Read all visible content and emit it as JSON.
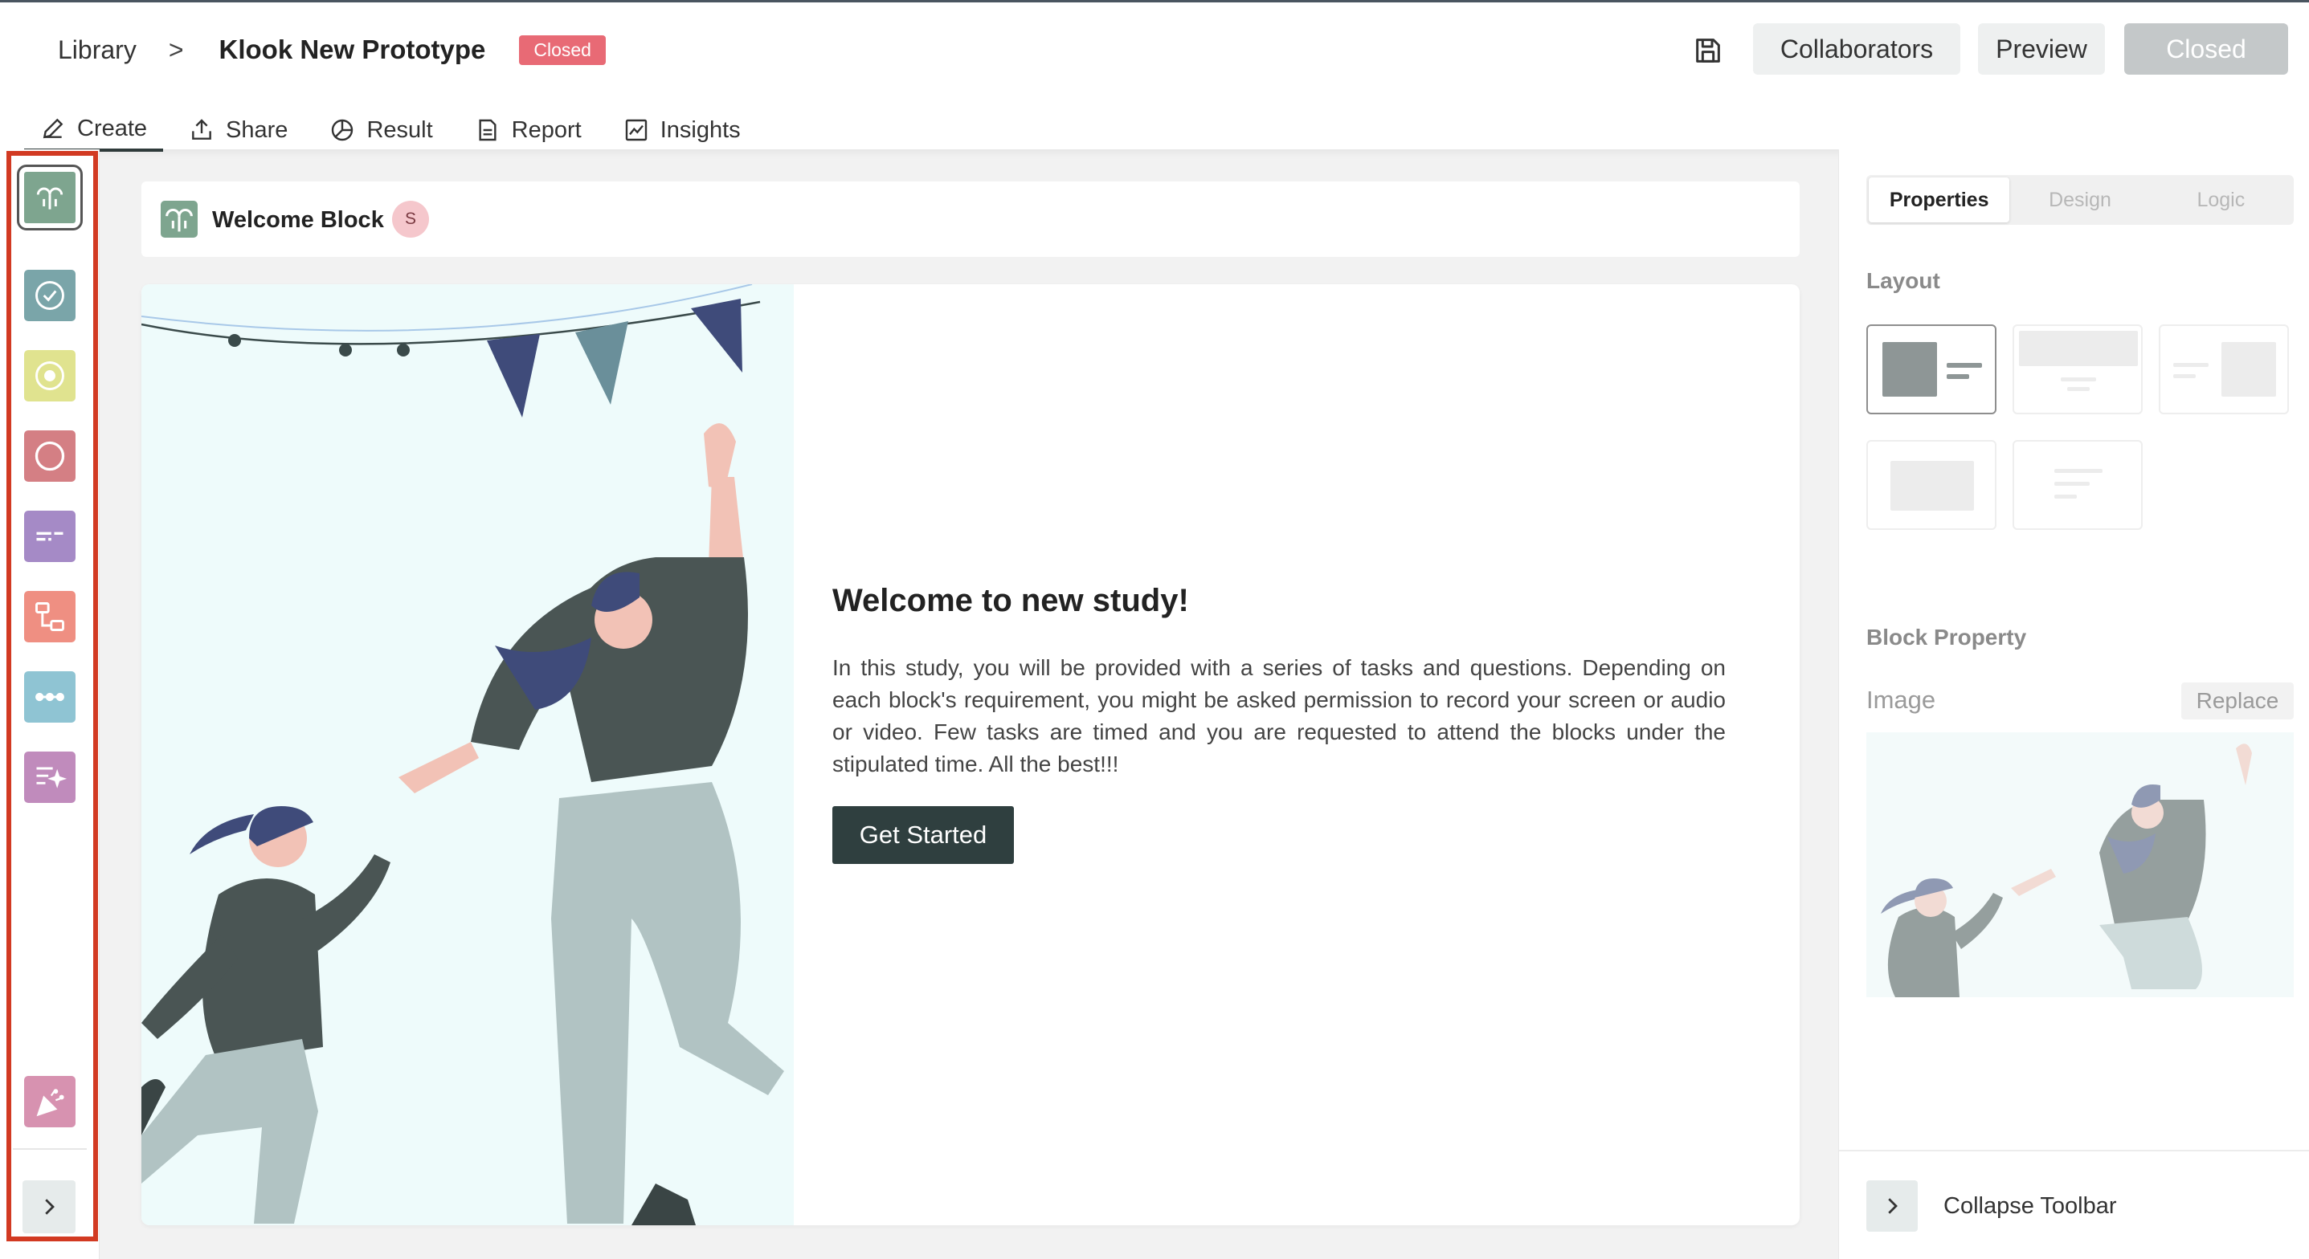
{
  "breadcrumb": {
    "library": "Library",
    "separator": ">",
    "project": "Klook New Prototype",
    "status": "Closed"
  },
  "header": {
    "collaborators": "Collaborators",
    "preview": "Preview",
    "closed": "Closed"
  },
  "tabs": [
    {
      "label": "Create",
      "icon": "pencil-icon",
      "active": true
    },
    {
      "label": "Share",
      "icon": "share-icon"
    },
    {
      "label": "Result",
      "icon": "pie-chart-icon"
    },
    {
      "label": "Report",
      "icon": "document-icon"
    },
    {
      "label": "Insights",
      "icon": "trend-chart-icon"
    }
  ],
  "sidebar": {
    "items": [
      {
        "name": "welcome-block",
        "color": "#7ea58f"
      },
      {
        "name": "task-block",
        "color": "#7aa5a9"
      },
      {
        "name": "target-block",
        "color": "#e0e38f"
      },
      {
        "name": "circle-block",
        "color": "#d47f84"
      },
      {
        "name": "text-block",
        "color": "#a58ac6"
      },
      {
        "name": "flow-block",
        "color": "#ef8f82"
      },
      {
        "name": "sequence-block",
        "color": "#8fc4d3"
      },
      {
        "name": "checklist-block",
        "color": "#c08bbc"
      },
      {
        "name": "thank-you-block",
        "color": "#d792b0"
      }
    ]
  },
  "block": {
    "title": "Welcome Block",
    "avatar": "S"
  },
  "welcome": {
    "title": "Welcome to new study!",
    "body": "In this study, you will be provided with a series of tasks and questions. Depending on each block's requirement, you might be asked permission to record your screen or audio or video. Few tasks are timed and you are requested to attend the blocks under the stipulated time. All the best!!!",
    "button": "Get Started"
  },
  "panel": {
    "tabs": [
      "Properties",
      "Design",
      "Logic"
    ],
    "layout_label": "Layout",
    "block_property_label": "Block Property",
    "image_label": "Image",
    "replace": "Replace",
    "collapse": "Collapse Toolbar"
  },
  "colors": {
    "accent": "#2f3f3f",
    "badge": "#e86a75",
    "highlight": "#d23a22"
  }
}
